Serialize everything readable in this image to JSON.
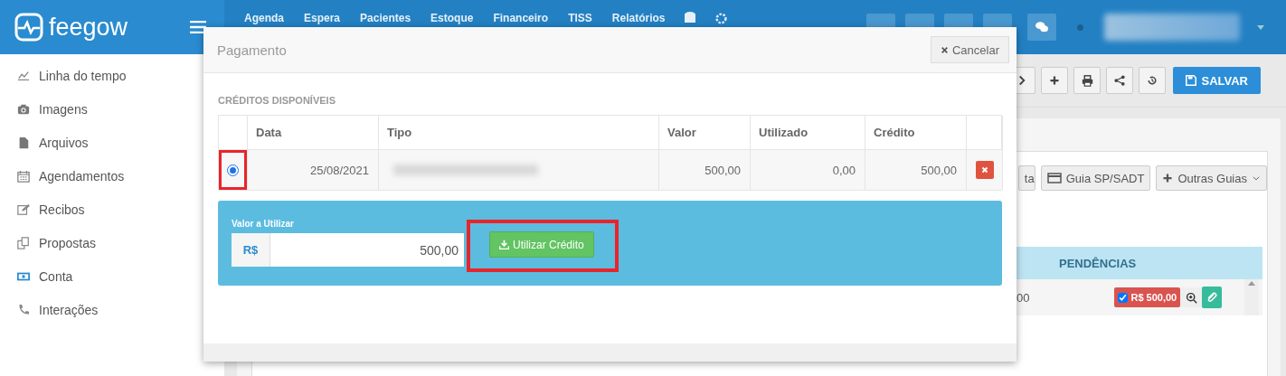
{
  "brand": {
    "name": "feegow"
  },
  "nav": {
    "items": [
      "Agenda",
      "Espera",
      "Pacientes",
      "Estoque",
      "Financeiro",
      "TISS",
      "Relatórios"
    ]
  },
  "sidebar": {
    "items": [
      {
        "label": "Linha do tempo"
      },
      {
        "label": "Imagens"
      },
      {
        "label": "Arquivos"
      },
      {
        "label": "Agendamentos"
      },
      {
        "label": "Recibos"
      },
      {
        "label": "Propostas"
      },
      {
        "label": "Conta"
      },
      {
        "label": "Interações"
      }
    ]
  },
  "toolbar": {
    "save_label": "SALVAR"
  },
  "background_card": {
    "buttons": [
      "ta",
      "Guia SP/SADT",
      "Outras Guias"
    ],
    "table_header": "PENDÊNCIAS",
    "row": {
      "cell": "00",
      "amount": "R$ 500,00",
      "checked": true
    }
  },
  "modal": {
    "title": "Pagamento",
    "cancel": "Cancelar",
    "section": "CRÉDITOS DISPONÍVEIS",
    "columns": [
      "Data",
      "Tipo",
      "Valor",
      "Utilizado",
      "Crédito"
    ],
    "rows": [
      {
        "selected": true,
        "highlighted": true,
        "date": "25/08/2021",
        "value": "500,00",
        "used": "0,00",
        "credit": "500,00"
      }
    ],
    "amount_label": "Valor a Utilizar",
    "currency": "R$",
    "amount_value": "500,00",
    "apply": "Utilizar Crédito",
    "apply_highlighted": true
  }
}
